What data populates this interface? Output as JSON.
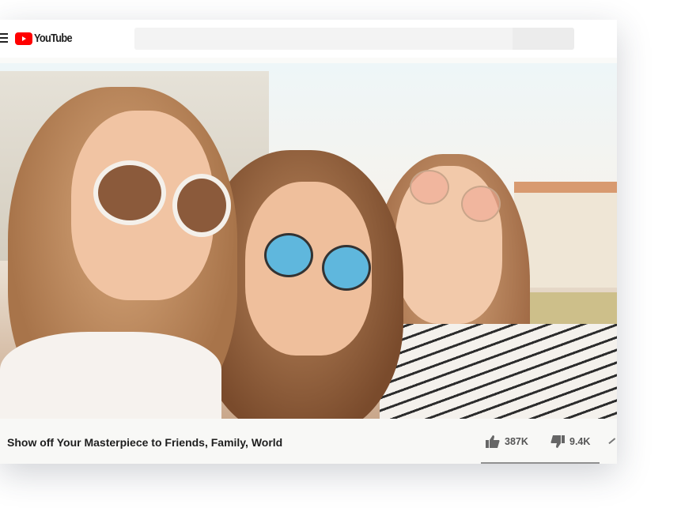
{
  "header": {
    "logo_text": "YouTube",
    "search_placeholder": ""
  },
  "video": {
    "title": "Show off Your Masterpiece to Friends, Family, World",
    "likes": "387K",
    "dislikes": "9.4K"
  },
  "colors": {
    "brand": "#ff0000"
  }
}
